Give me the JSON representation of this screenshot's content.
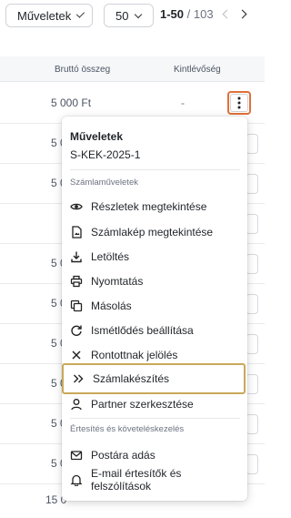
{
  "toolbar": {
    "actions_select": "Műveletek",
    "page_size": "50",
    "range": "1-50",
    "total": "/ 103"
  },
  "table": {
    "columns": [
      "Bruttó összeg",
      "Kintlévőség"
    ],
    "rows": [
      {
        "amount": "5 000  Ft",
        "outstanding": "-"
      },
      {
        "amount": "5 0",
        "outstanding": ""
      },
      {
        "amount": "5 0",
        "outstanding": ""
      },
      {
        "amount": "",
        "outstanding": ""
      },
      {
        "amount": "5 0",
        "outstanding": ""
      },
      {
        "amount": "5 0",
        "outstanding": ""
      },
      {
        "amount": "5 0",
        "outstanding": ""
      },
      {
        "amount": "5 0",
        "outstanding": ""
      },
      {
        "amount": "5 0",
        "outstanding": ""
      },
      {
        "amount": "5 0",
        "outstanding": ""
      },
      {
        "amount": "15 0",
        "outstanding": ""
      }
    ]
  },
  "menu": {
    "title": "Műveletek",
    "invoice_id": "S-KEK-2025-1",
    "section_invoice": "Számlaműveletek",
    "items": [
      {
        "label": "Részletek megtekintése",
        "icon": "eye-icon"
      },
      {
        "label": "Számlakép megtekintése",
        "icon": "file-image-icon"
      },
      {
        "label": "Letöltés",
        "icon": "download-icon"
      },
      {
        "label": "Nyomtatás",
        "icon": "printer-icon"
      },
      {
        "label": "Másolás",
        "icon": "copy-icon"
      },
      {
        "label": "Ismétlődés beállítása",
        "icon": "repeat-icon"
      },
      {
        "label": "Rontottnak jelölés",
        "icon": "x-icon"
      },
      {
        "label": "Számlakészítés",
        "icon": "double-chevron-right-icon"
      },
      {
        "label": "Partner szerkesztése",
        "icon": "user-icon"
      }
    ],
    "section_notify": "Értesítés és követeléskezelés",
    "notify_items": [
      {
        "label": "Postára adás",
        "icon": "envelope-icon"
      },
      {
        "label": "E-mail értesítők és felszólítások",
        "icon": "bell-icon"
      }
    ]
  },
  "colors": {
    "highlight_border": "#e0703a",
    "active_item_border": "#c9a85a"
  }
}
